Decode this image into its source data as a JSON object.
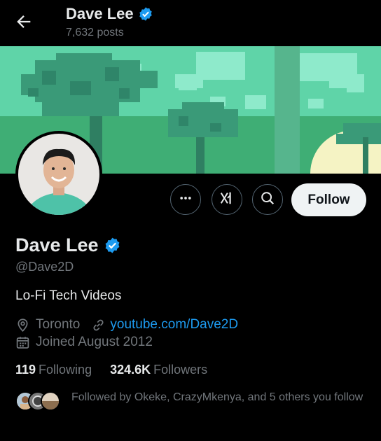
{
  "header": {
    "name": "Dave Lee",
    "posts_count": "7,632 posts"
  },
  "colors": {
    "verified_badge": "#1d9bf0",
    "link": "#1d9bf0",
    "banner_sky": "#5fd4a8",
    "banner_ground": "#3fae75"
  },
  "actions": {
    "more_icon": "more-icon",
    "grok_icon": "grok-icon",
    "search_icon": "search-icon",
    "follow_label": "Follow"
  },
  "profile": {
    "display_name": "Dave Lee",
    "handle": "@Dave2D",
    "bio": "Lo-Fi Tech Videos",
    "location": "Toronto",
    "website": "youtube.com/Dave2D",
    "joined": "Joined August 2012"
  },
  "stats": {
    "following_count": "119",
    "following_label": "Following",
    "followers_count": "324.6K",
    "followers_label": "Followers"
  },
  "followed_by": {
    "text": "Followed by Okeke, CrazyMkenya, and 5 others you follow"
  }
}
